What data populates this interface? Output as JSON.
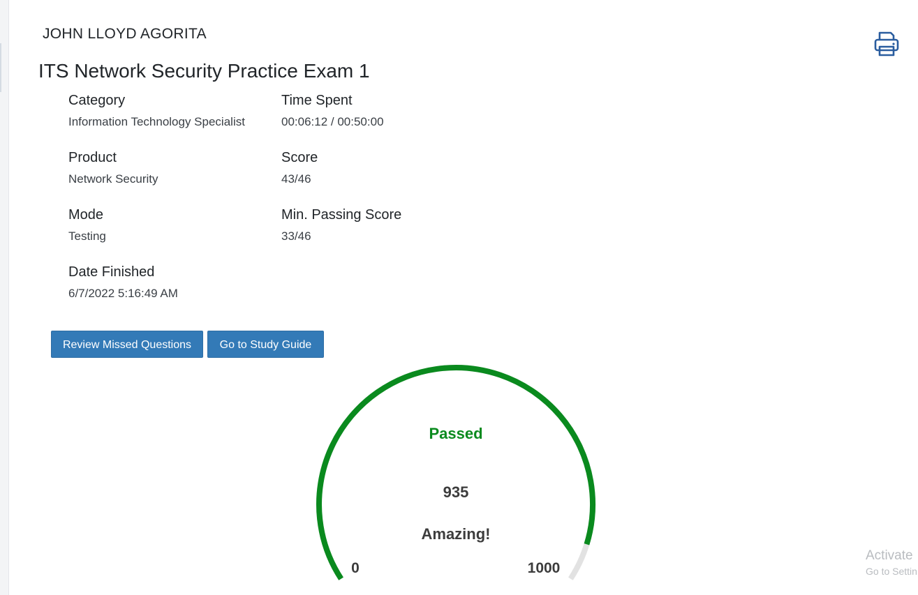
{
  "header": {
    "user_name": "JOHN LLOYD AGORITA",
    "print_icon": "printer-icon"
  },
  "exam": {
    "title": "ITS Network Security Practice Exam 1",
    "details": {
      "category": {
        "label": "Category",
        "value": "Information Technology Specialist"
      },
      "time_spent": {
        "label": "Time Spent",
        "value": "00:06:12 / 00:50:00"
      },
      "product": {
        "label": "Product",
        "value": "Network Security"
      },
      "score": {
        "label": "Score",
        "value": "43/46"
      },
      "mode": {
        "label": "Mode",
        "value": "Testing"
      },
      "min_passing": {
        "label": "Min. Passing Score",
        "value": "33/46"
      },
      "date_finished": {
        "label": "Date Finished",
        "value": "6/7/2022 5:16:49 AM"
      }
    }
  },
  "actions": {
    "review_missed_label": "Review Missed Questions",
    "study_guide_label": "Go to Study Guide",
    "button_color": "#337ab7"
  },
  "gauge": {
    "status": "Passed",
    "value": 935,
    "value_text": "935",
    "min_text": "0",
    "max_text": "1000",
    "min": 0,
    "max": 1000,
    "message": "Amazing!",
    "fill_color": "#0a8a1e",
    "track_color": "#e2e2e2"
  },
  "watermark": {
    "line1": "Activate",
    "line2": "Go to Settin"
  }
}
